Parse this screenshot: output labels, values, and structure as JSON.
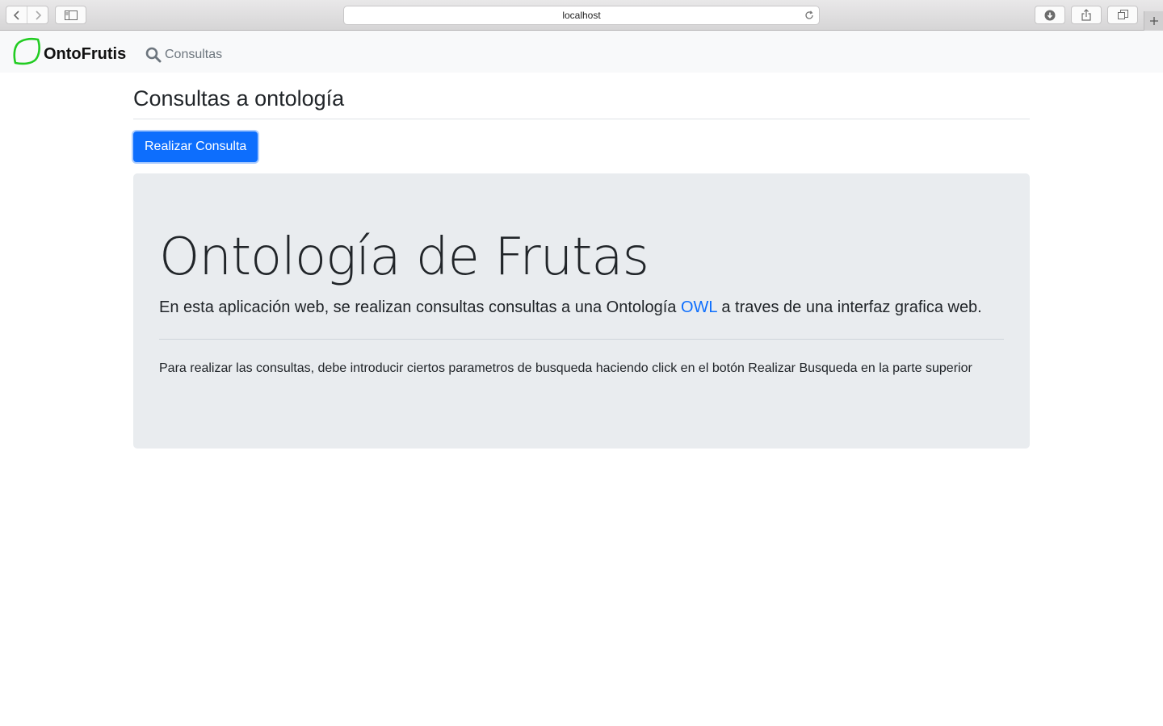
{
  "browser": {
    "url": "localhost",
    "icons": {
      "back": "chevron-left-icon",
      "forward": "chevron-right-icon",
      "sidebar": "sidebar-icon",
      "reload": "reload-icon",
      "download": "download-icon",
      "share": "share-icon",
      "tabs": "tabs-icon",
      "new_tab": "plus-icon"
    }
  },
  "navbar": {
    "brand": "OntoFrutis",
    "brand_color": "#22cc22",
    "link_label": "Consultas"
  },
  "page": {
    "title": "Consultas a ontología",
    "button_label": "Realizar Consulta",
    "accent_color": "#0d6efd"
  },
  "jumbotron": {
    "heading": "Ontología de Frutas",
    "lead_before": "En esta aplicación web, se realizan consultas consultas a una Ontología ",
    "lead_link": "OWL",
    "lead_after": " a traves de una interfaz grafica web.",
    "body": "Para realizar las consultas, debe introducir ciertos parametros de busqueda haciendo click en el botón Realizar Busqueda en la parte superior"
  }
}
